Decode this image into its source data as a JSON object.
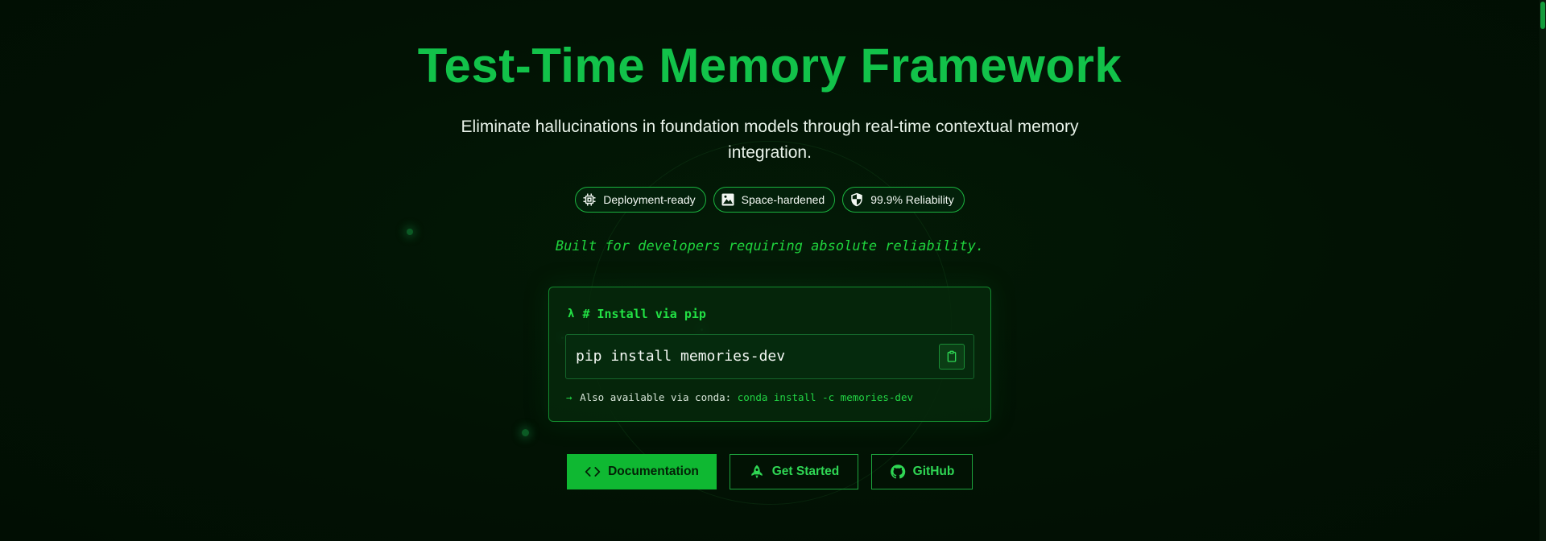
{
  "hero": {
    "title": "Test-Time Memory Framework",
    "subtitle": "Eliminate hallucinations in foundation models through real-time contextual memory integration.",
    "tagline": "Built for developers requiring absolute reliability."
  },
  "badges": [
    {
      "label": "Deployment-ready",
      "icon": "chip-icon"
    },
    {
      "label": "Space-hardened",
      "icon": "image-landscape-icon"
    },
    {
      "label": "99.9% Reliability",
      "icon": "shield-icon"
    }
  ],
  "install": {
    "header": "# Install via pip",
    "command": "pip install memories-dev",
    "alt_arrow": "→",
    "alt_prefix": "Also available via conda:",
    "alt_command": "conda install -c memories-dev"
  },
  "buttons": {
    "documentation": "Documentation",
    "get_started": "Get Started",
    "github": "GitHub"
  },
  "colors": {
    "background": "#021204",
    "accent": "#12c24a",
    "primary_button": "#0fb832",
    "text": "#e9f3ea"
  }
}
